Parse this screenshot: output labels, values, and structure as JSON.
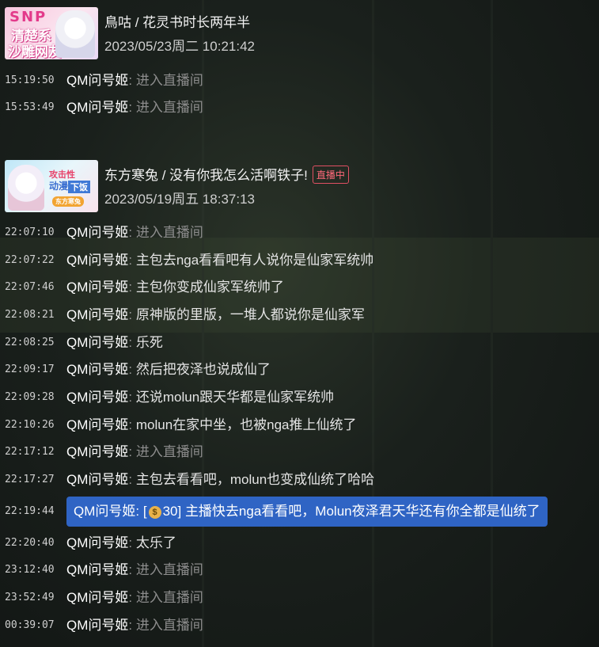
{
  "sessions": [
    {
      "thumb_text": [
        "SNP",
        "清楚系",
        "沙雕网友"
      ],
      "title": "鳥咕 / 花灵书时长两年半",
      "date": "2023/05/23周二  10:21:42",
      "live_badge": "",
      "messages": [
        {
          "time": "15:19:50",
          "user": "QM问号姬",
          "text": "进入直播间",
          "type": "enter"
        },
        {
          "time": "15:53:49",
          "user": "QM问号姬",
          "text": "进入直播间",
          "type": "enter"
        }
      ]
    },
    {
      "thumb_text": [
        "攻击性",
        "动漫",
        "下饭",
        "东方寒兔"
      ],
      "title": "东方寒兔 / 没有你我怎么活啊铁子!",
      "date": "2023/05/19周五  18:37:13",
      "live_badge": "直播中",
      "messages": [
        {
          "time": "22:07:10",
          "user": "QM问号姬",
          "text": "进入直播间",
          "type": "enter"
        },
        {
          "time": "22:07:22",
          "user": "QM问号姬",
          "text": "主包去nga看看吧有人说你是仙家军统帅",
          "type": "chat"
        },
        {
          "time": "22:07:46",
          "user": "QM问号姬",
          "text": "主包你变成仙家军统帅了",
          "type": "chat"
        },
        {
          "time": "22:08:21",
          "user": "QM问号姬",
          "text": "原神版的里版，一堆人都说你是仙家军",
          "type": "chat"
        },
        {
          "time": "22:08:25",
          "user": "QM问号姬",
          "text": "乐死",
          "type": "chat"
        },
        {
          "time": "22:09:17",
          "user": "QM问号姬",
          "text": "然后把夜泽也说成仙了",
          "type": "chat"
        },
        {
          "time": "22:09:28",
          "user": "QM问号姬",
          "text": "还说molun跟天华都是仙家军统帅",
          "type": "chat"
        },
        {
          "time": "22:10:26",
          "user": "QM问号姬",
          "text": "molun在家中坐，也被nga推上仙统了",
          "type": "chat"
        },
        {
          "time": "22:17:12",
          "user": "QM问号姬",
          "text": "进入直播间",
          "type": "enter"
        },
        {
          "time": "22:17:27",
          "user": "QM问号姬",
          "text": "主包去看看吧，molun也变成仙统了哈哈",
          "type": "chat"
        },
        {
          "time": "22:19:44",
          "user": "QM问号姬",
          "text": "主播快去nga看看吧，Molun夜泽君天华还有你全都是仙统了",
          "type": "superchat",
          "amount": "30"
        },
        {
          "time": "22:20:40",
          "user": "QM问号姬",
          "text": "太乐了",
          "type": "chat"
        },
        {
          "time": "23:12:40",
          "user": "QM问号姬",
          "text": "进入直播间",
          "type": "enter"
        },
        {
          "time": "23:52:49",
          "user": "QM问号姬",
          "text": "进入直播间",
          "type": "enter"
        },
        {
          "time": "00:39:07",
          "user": "QM问号姬",
          "text": "进入直播间",
          "type": "enter"
        }
      ]
    }
  ],
  "colors": {
    "superchat_bg": "#2f64c4",
    "live_badge": "#e05063",
    "dim_text": "#8c8c8c"
  }
}
